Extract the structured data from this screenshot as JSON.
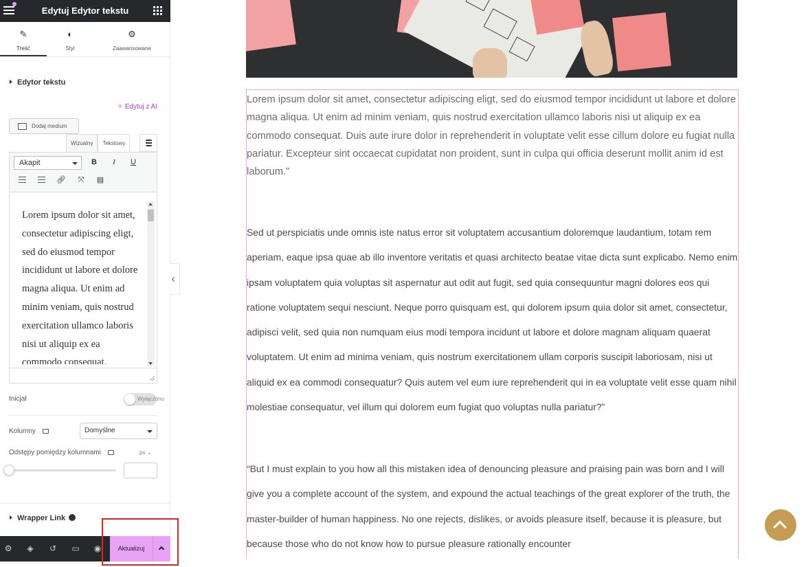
{
  "header": {
    "title": "Edytuj Edytor tekstu"
  },
  "tabs": [
    {
      "label": "Treść",
      "icon": "pencil-icon"
    },
    {
      "label": "Styl",
      "icon": "half-circle-icon"
    },
    {
      "label": "Zaawansowane",
      "icon": "gear-icon"
    }
  ],
  "section": {
    "title": "Edytor tekstu"
  },
  "editor": {
    "ai_label": "Edytuj z AI",
    "add_media": "Dodaj medium",
    "mode_visual": "Wizualny",
    "mode_text": "Tekstowy",
    "format_value": "Akapit",
    "bold": "B",
    "italic": "I",
    "underline": "U",
    "content": "Lorem ipsum dolor sit amet, consectetur adipiscing eligt, sed do eiusmod tempor incididunt ut labore et dolore magna aliqua. Ut enim ad minim veniam, quis nostrud exercitation ullamco laboris nisi ut aliquip ex ea commodo consequat."
  },
  "controls": {
    "dropcap_label": "Inicjał",
    "dropcap_value": "Wyłączono",
    "columns_label": "Kolumny",
    "columns_value": "Domyślne",
    "gap_label": "Odstępy pomiędzy kolumnami",
    "gap_unit": "px"
  },
  "wrapper": {
    "title": "Wrapper Link"
  },
  "footer": {
    "publish_label": "Aktualizuj"
  },
  "content": {
    "p1": "Lorem ipsum dolor sit amet, consectetur adipiscing eligt, sed do eiusmod tempor incididunt ut labore et dolore magna aliqua. Ut enim ad minim veniam, quis nostrud exercitation ullamco laboris nisi ut aliquip ex ea commodo consequat. Duis aute irure dolor in reprehenderit in voluptate velit esse cillum dolore eu fugiat nulla pariatur. Excepteur sint occaecat cupidatat non proident, sunt in culpa qui officia deserunt mollit anim id est laborum.”",
    "p2": "Sed ut perspiciatis unde omnis iste natus error sit voluptatem accusantium doloremque laudantium, totam rem aperiam, eaque ipsa quae ab illo inventore veritatis et quasi architecto beatae vitae dicta sunt explicabo. Nemo enim ipsam voluptatem quia voluptas sit aspernatur aut odit aut fugit, sed quia consequuntur magni dolores eos qui ratione voluptatem sequi nesciunt. Neque porro quisquam est, qui dolorem ipsum quia dolor sit amet, consectetur, adipisci velit, sed quia non numquam eius modi tempora incidunt ut labore et dolore magnam aliquam quaerat voluptatem. Ut enim ad minima veniam, quis nostrum exercitationem ullam corporis suscipit laboriosam, nisi ut aliquid ex ea commodi consequatur? Quis autem vel eum iure reprehenderit qui in ea voluptate velit esse quam nihil molestiae consequatur, vel illum qui dolorem eum fugiat quo voluptas nulla pariatur?”",
    "p3": "“But I must explain to you how all this mistaken idea of denouncing pleasure and praising pain was born and I will give you a complete account of the system, and expound the actual teachings of the great explorer of the truth, the master-builder of human happiness. No one rejects, dislikes, or avoids pleasure itself, because it is pleasure, but because those who do not know how to pursue pleasure rationally encounter"
  },
  "colors": {
    "accent": "#e8a3f7",
    "dark": "#26292c",
    "ai_purple": "#c036d9",
    "highlight_red": "#e02424",
    "scroll_top": "#c69c55"
  }
}
